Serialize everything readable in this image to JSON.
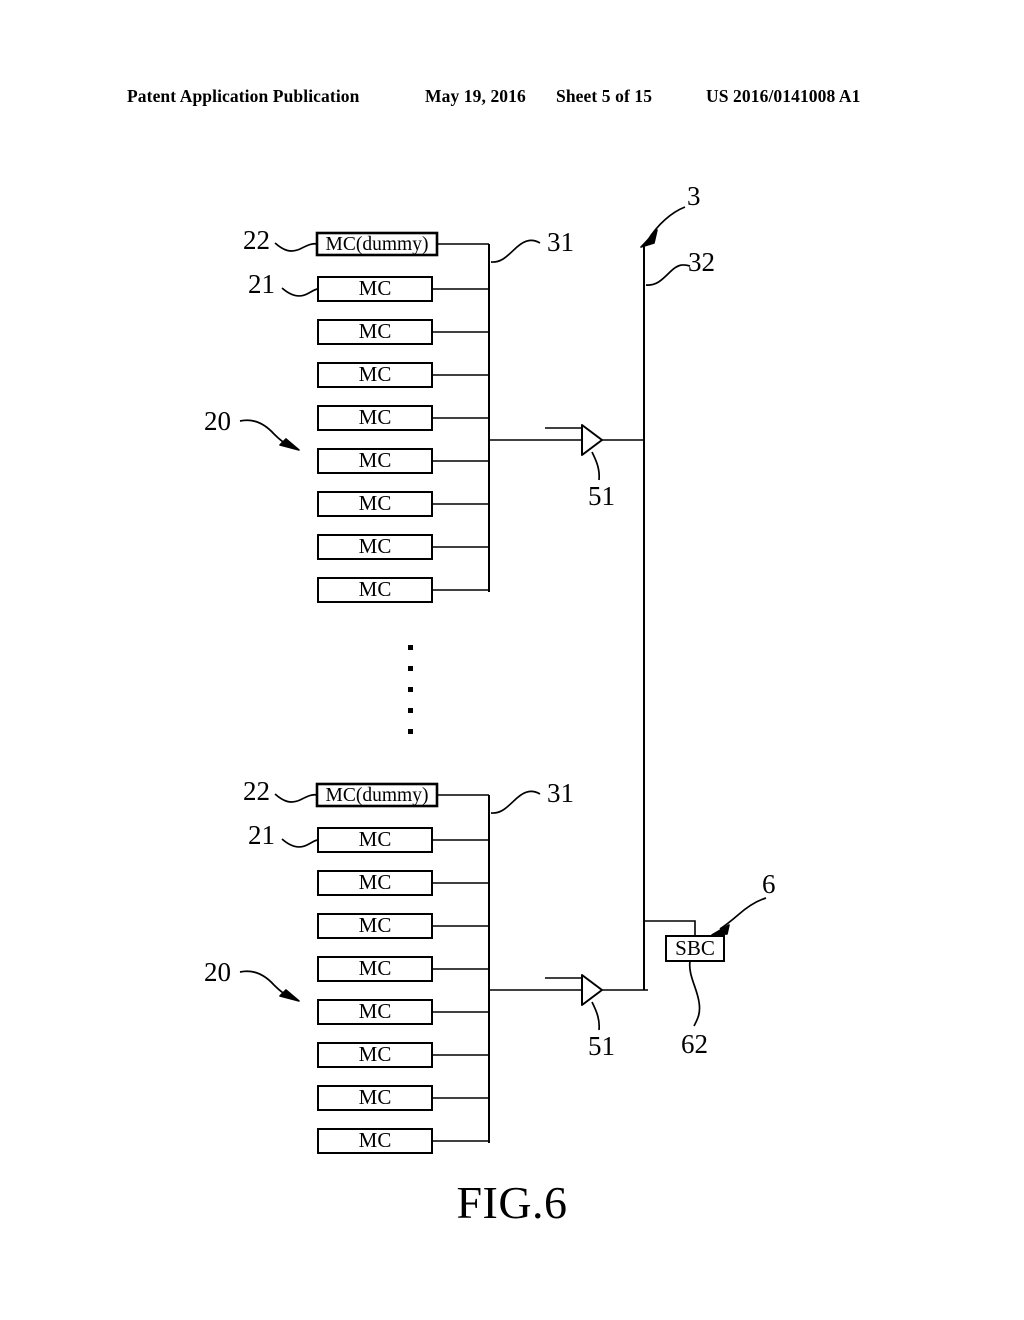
{
  "header": {
    "publication": "Patent Application Publication",
    "date": "May 19, 2016",
    "sheet": "Sheet 5 of 15",
    "doc_number": "US 2016/0141008 A1"
  },
  "figure": {
    "caption": "FIG.6",
    "groups": [
      {
        "id": "top-group",
        "group_ref": "20",
        "bus_ref": "31",
        "driver_ref": "51",
        "dummy_ref": "22",
        "cell_ref": "21",
        "blocks": [
          {
            "label": "MC(dummy)",
            "type": "dummy"
          },
          {
            "label": "MC",
            "type": "cell"
          },
          {
            "label": "MC",
            "type": "cell"
          },
          {
            "label": "MC",
            "type": "cell"
          },
          {
            "label": "MC",
            "type": "cell"
          },
          {
            "label": "MC",
            "type": "cell"
          },
          {
            "label": "MC",
            "type": "cell"
          },
          {
            "label": "MC",
            "type": "cell"
          },
          {
            "label": "MC",
            "type": "cell"
          }
        ]
      },
      {
        "id": "bottom-group",
        "group_ref": "20",
        "bus_ref": "31",
        "driver_ref": "51",
        "dummy_ref": "22",
        "cell_ref": "21",
        "blocks": [
          {
            "label": "MC(dummy)",
            "type": "dummy"
          },
          {
            "label": "MC",
            "type": "cell"
          },
          {
            "label": "MC",
            "type": "cell"
          },
          {
            "label": "MC",
            "type": "cell"
          },
          {
            "label": "MC",
            "type": "cell"
          },
          {
            "label": "MC",
            "type": "cell"
          },
          {
            "label": "MC",
            "type": "cell"
          },
          {
            "label": "MC",
            "type": "cell"
          },
          {
            "label": "MC",
            "type": "cell"
          }
        ]
      }
    ],
    "main_bus_ref": "3",
    "main_bus_branch_ref": "32",
    "controller": {
      "label": "SBC",
      "ref": "6",
      "link_ref": "62"
    },
    "ellipsis_dots": 5,
    "line_color": "#000000"
  }
}
